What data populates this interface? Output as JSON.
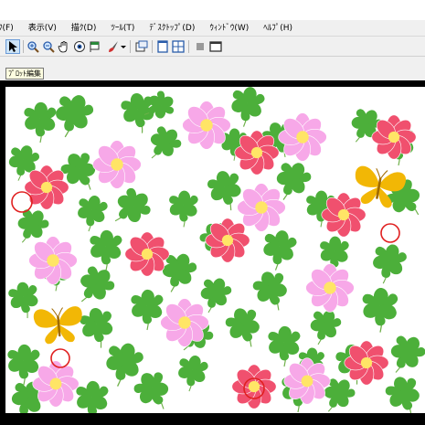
{
  "menu": {
    "items": [
      {
        "label": "ﾌ(F)"
      },
      {
        "label": "表示(V)"
      },
      {
        "label": "描ｸ(D)"
      },
      {
        "label": "ﾂｰﾙ(T)"
      },
      {
        "label": "ﾃﾞｽｸﾄｯﾌﾟ(D)"
      },
      {
        "label": "ｳｨﾝﾄﾞｳ(W)"
      },
      {
        "label": "ﾍﾙﾌﾟ(H)"
      }
    ]
  },
  "toolbar": {
    "buttons": [
      {
        "icon": "pointer-icon",
        "selected": true
      },
      {
        "icon": "zoom-in-icon"
      },
      {
        "icon": "zoom-out-icon"
      },
      {
        "icon": "hand-icon"
      },
      {
        "icon": "eye-icon"
      },
      {
        "icon": "flag-icon"
      },
      {
        "icon": "brush-icon"
      },
      {
        "icon": "dropdown-arrow-icon"
      },
      {
        "icon": "copy-window-icon"
      },
      {
        "icon": "single-window-icon"
      },
      {
        "icon": "tile-window-icon"
      },
      {
        "icon": "gray-square-icon"
      },
      {
        "icon": "frame-window-icon"
      }
    ]
  },
  "tooltip": {
    "text": "ﾌﾟﾛｯﾄ編集"
  },
  "picture": {
    "background": "#ffffff",
    "clover_color": "#4caf3a",
    "pink_flower_color": "#f7a8e8",
    "red_flower_color": "#f0506e",
    "butterfly_color": "#f2b705",
    "circle_marker_color": "#e02020"
  }
}
